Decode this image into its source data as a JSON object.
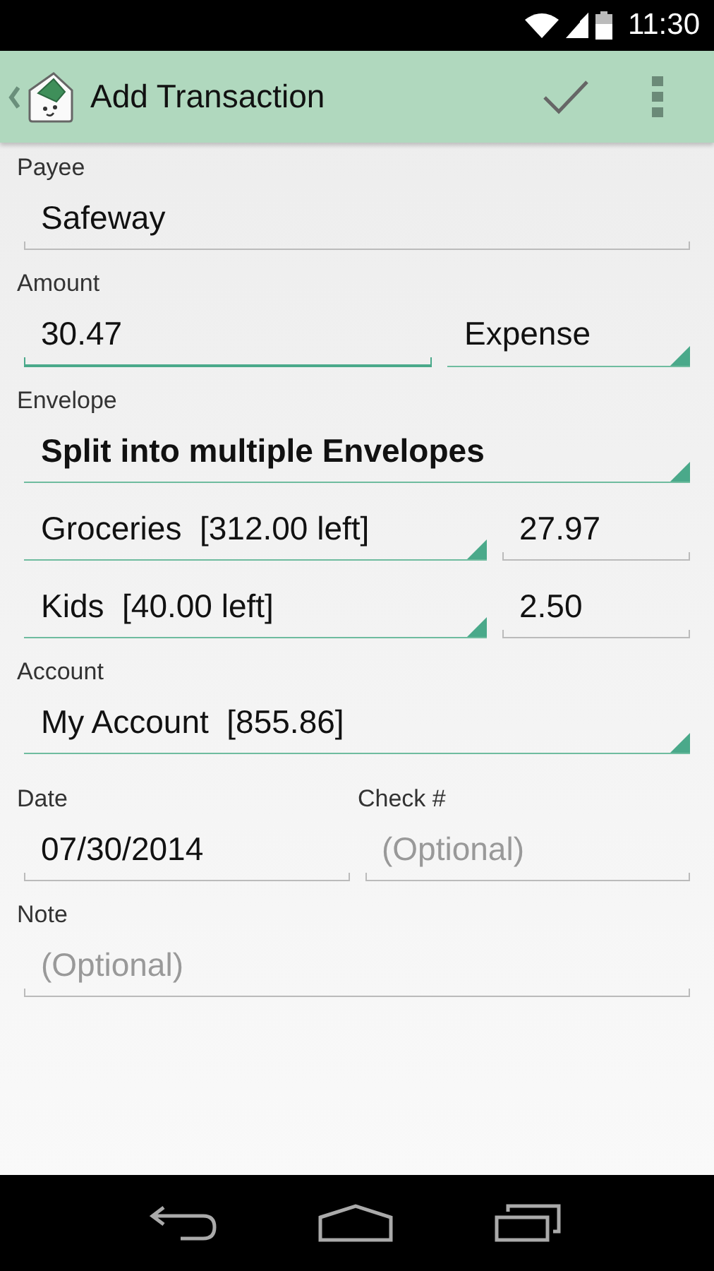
{
  "status_bar": {
    "time": "11:30"
  },
  "action_bar": {
    "title": "Add Transaction"
  },
  "sections": [
    {
      "kind": "single",
      "label": "Payee",
      "rows": [
        [
          {
            "kind": "text",
            "value": "Safeway",
            "focused": false
          }
        ]
      ]
    },
    {
      "kind": "single",
      "label": "Amount",
      "rows": [
        [
          {
            "kind": "text",
            "value": "30.47",
            "focused": true
          },
          {
            "kind": "spinner",
            "value": "Expense",
            "emphasized": false
          }
        ]
      ]
    },
    {
      "kind": "single",
      "label": "Envelope",
      "rows": [
        [
          {
            "kind": "spinner",
            "value": "Split into multiple Envelopes",
            "emphasized": true
          }
        ],
        [
          {
            "kind": "spinner",
            "value": "Groceries  [312.00 left]",
            "emphasized": false
          },
          {
            "kind": "text",
            "value": "27.97",
            "focused": false
          }
        ],
        [
          {
            "kind": "spinner",
            "value": "Kids  [40.00 left]",
            "emphasized": false
          },
          {
            "kind": "text",
            "value": "2.50",
            "focused": false
          }
        ]
      ]
    },
    {
      "kind": "single",
      "label": "Account",
      "rows": [
        [
          {
            "kind": "spinner",
            "value": "My Account  [855.86]",
            "emphasized": false
          }
        ]
      ]
    },
    {
      "kind": "pair",
      "columns": [
        {
          "label": "Date",
          "field": {
            "kind": "text",
            "value": "07/30/2014",
            "focused": false
          }
        },
        {
          "label": "Check #",
          "field": {
            "kind": "text",
            "placeholder": "(Optional)",
            "focused": false
          }
        }
      ]
    },
    {
      "kind": "single",
      "label": "Note",
      "rows": [
        [
          {
            "kind": "text",
            "placeholder": "(Optional)",
            "focused": false
          }
        ]
      ]
    }
  ]
}
